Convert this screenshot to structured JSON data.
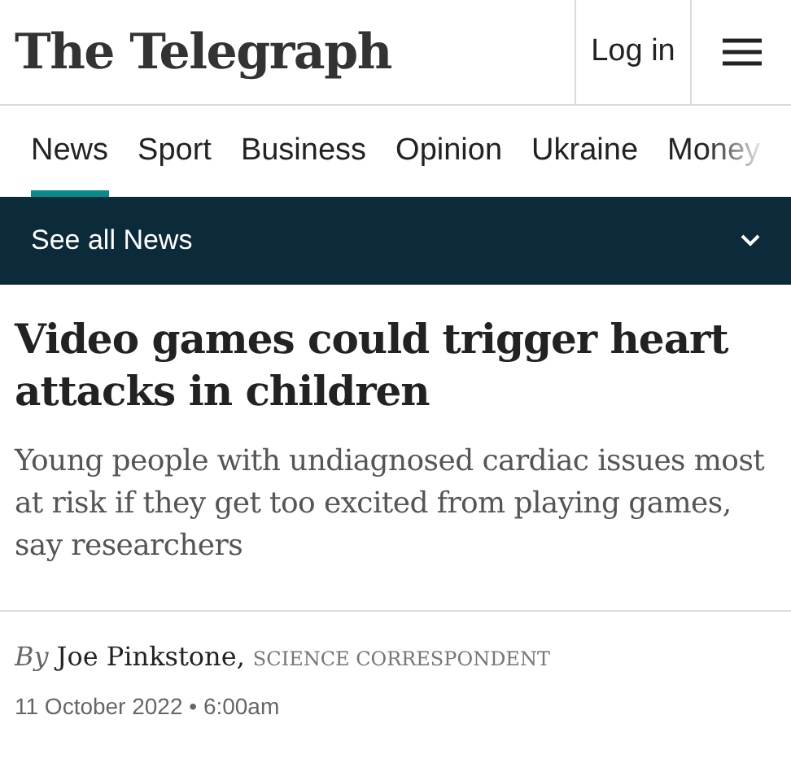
{
  "header": {
    "logo": "The Telegraph",
    "login": "Log in"
  },
  "nav": [
    {
      "label": "News",
      "selected": true
    },
    {
      "label": "Sport",
      "selected": false
    },
    {
      "label": "Business",
      "selected": false
    },
    {
      "label": "Opinion",
      "selected": false
    },
    {
      "label": "Ukraine",
      "selected": false
    },
    {
      "label": "Money",
      "selected": false
    }
  ],
  "subnav": {
    "label": "See all News"
  },
  "article": {
    "headline": "Video games could trigger heart attacks in children",
    "standfirst": "Young people with undiagnosed cardiac issues most at risk if they get too excited from playing games, say researchers",
    "by": "By",
    "author": "Joe Pinkstone,",
    "role": "SCIENCE CORRESPONDENT",
    "date": "11 October 2022 • 6:00am"
  }
}
